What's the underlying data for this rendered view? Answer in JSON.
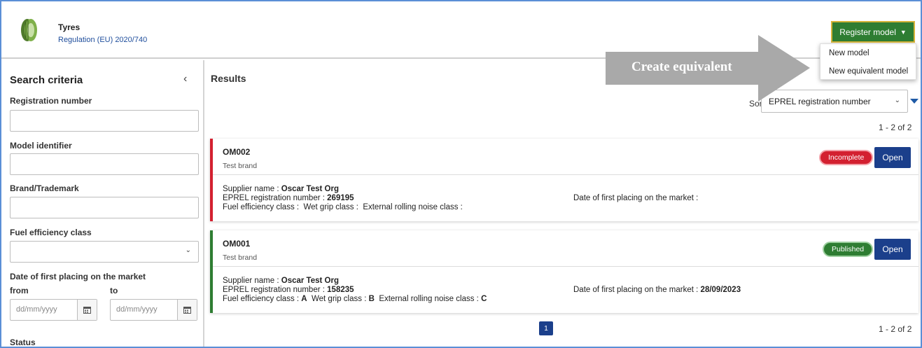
{
  "header": {
    "title": "Tyres",
    "regulation": "Regulation (EU) 2020/740",
    "register_button": "Register model",
    "dropdown_items": [
      "New model",
      "New equivalent model"
    ],
    "callout_text": "Create equivalent"
  },
  "sidebar": {
    "title": "Search criteria",
    "fields": {
      "registration_number": "Registration number",
      "model_identifier": "Model identifier",
      "brand": "Brand/Trademark",
      "fuel_efficiency": "Fuel efficiency class",
      "date_placing": "Date of first placing on the market",
      "from": "from",
      "to": "to",
      "date_placeholder": "dd/mm/yyyy",
      "status": "Status"
    }
  },
  "results": {
    "title": "Results",
    "sort_label": "Sort:",
    "sort_value": "EPREL registration number",
    "count": "1 - 2 of 2",
    "page": "1",
    "items": [
      {
        "id": "OM002",
        "brand": "Test brand",
        "status": "Incomplete",
        "open_label": "Open",
        "supplier_label": "Supplier name :",
        "supplier": "Oscar Test Org",
        "reg_label": "EPREL registration number :",
        "reg_number": "269195",
        "classes_prefix": "Fuel efficiency class :",
        "fuel_class": "",
        "wet_label": "Wet grip class :",
        "wet_class": "",
        "noise_label": "External rolling noise class :",
        "noise_class": "",
        "date_label": "Date of first placing on the market :",
        "date": ""
      },
      {
        "id": "OM001",
        "brand": "Test brand",
        "status": "Published",
        "open_label": "Open",
        "supplier_label": "Supplier name :",
        "supplier": "Oscar Test Org",
        "reg_label": "EPREL registration number :",
        "reg_number": "158235",
        "classes_prefix": "Fuel efficiency class :",
        "fuel_class": "A",
        "wet_label": "Wet grip class :",
        "wet_class": "B",
        "noise_label": "External rolling noise class :",
        "noise_class": "C",
        "date_label": "Date of first placing on the market :",
        "date": "28/09/2023"
      }
    ]
  },
  "colors": {
    "primary": "#1b3f8b",
    "register_green": "#2e7d32",
    "incomplete_red": "#d32030",
    "callout_gray": "#a9a9a9"
  }
}
